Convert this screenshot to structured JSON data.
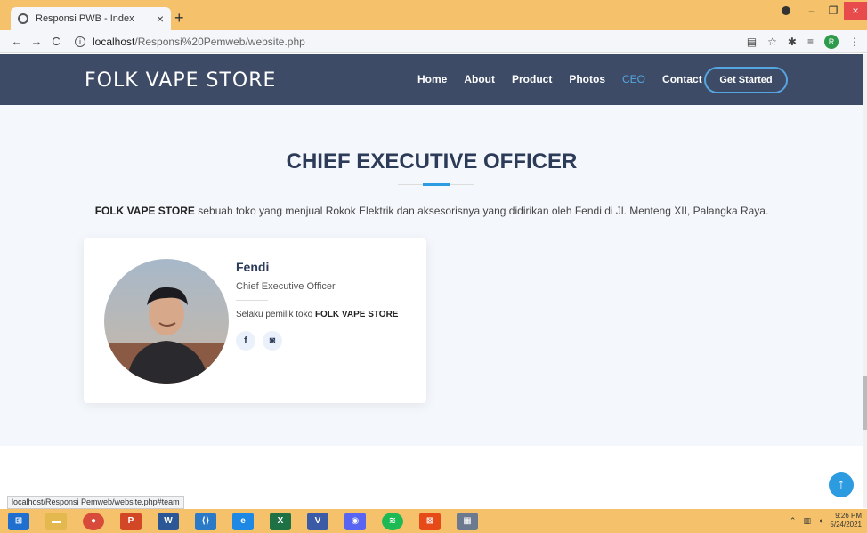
{
  "browser": {
    "tab_title": "Responsi PWB - Index",
    "tab_close": "×",
    "new_tab": "+",
    "url_host": "localhost",
    "url_path": "/Responsi%20Pemweb/website.php",
    "status_url": "localhost/Responsi Pemweb/website.php#team",
    "profile_initial": "R"
  },
  "site": {
    "logo": "FOLK VAPE STORE",
    "menu": [
      "Home",
      "About",
      "Product",
      "Photos",
      "CEO",
      "Contact"
    ],
    "active_menu": "CEO",
    "cta": "Get Started"
  },
  "section": {
    "title": "CHIEF EXECUTIVE OFFICER",
    "desc_bold": "FOLK VAPE STORE",
    "desc_rest": " sebuah toko yang menjual Rokok Elektrik dan aksesorisnya yang didirikan oleh Fendi di Jl. Menteng XII, Palangka Raya."
  },
  "member": {
    "name": "Fendi",
    "role": "Chief Executive Officer",
    "desc_prefix": "Selaku pemilik toko ",
    "desc_bold": "FOLK VAPE STORE",
    "socials": [
      "f",
      "◙"
    ]
  },
  "taskbar": {
    "time": "9:26 PM",
    "date": "5/24/2021"
  },
  "colors": {
    "header_bg": "#3d4b66",
    "accent": "#2d9be0",
    "title": "#2c3b58",
    "chrome": "#f5c26b"
  }
}
